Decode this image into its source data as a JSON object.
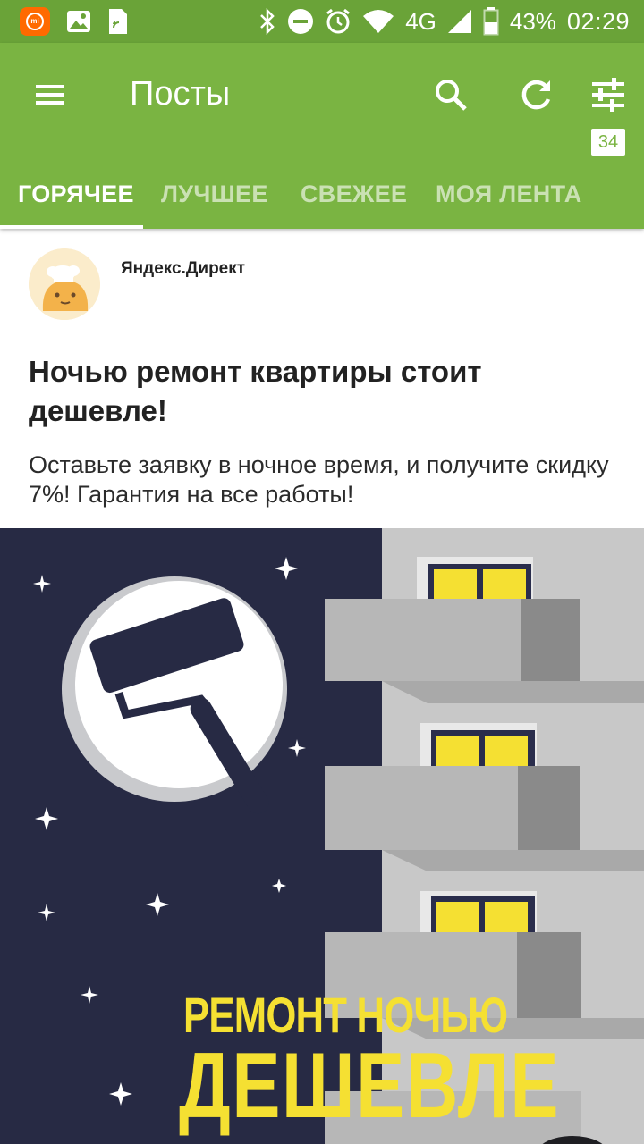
{
  "status_bar": {
    "battery_percent": "43%",
    "time": "02:29",
    "network": "4G"
  },
  "app_bar": {
    "title": "Посты",
    "menu_icon": "hamburger-menu-icon",
    "actions": [
      "search-icon",
      "refresh-icon",
      "filter-sliders-icon"
    ]
  },
  "tabs": [
    {
      "label": "ГОРЯЧЕЕ",
      "active": true
    },
    {
      "label": "ЛУЧШЕЕ",
      "active": false
    },
    {
      "label": "СВЕЖЕЕ",
      "active": false
    },
    {
      "label": "МОЯ ЛЕНТА",
      "active": false
    }
  ],
  "feed_badge": "34",
  "post": {
    "author": "Яндекс.Директ",
    "title": "Ночью ремонт квартиры стоит дешевле!",
    "description": "Оставьте заявку в ночное время, и получите скидку 7%! Гарантия на все работы!",
    "banner": {
      "line1": "РЕМОНТ НОЧЬЮ",
      "line2": "ДЕШЕВЛЕ"
    }
  },
  "colors": {
    "status_bar": "#6aa338",
    "app_bar": "#7ab442",
    "banner_night": "#272a44",
    "banner_text": "#f5e032",
    "window_light": "#f5e032"
  }
}
